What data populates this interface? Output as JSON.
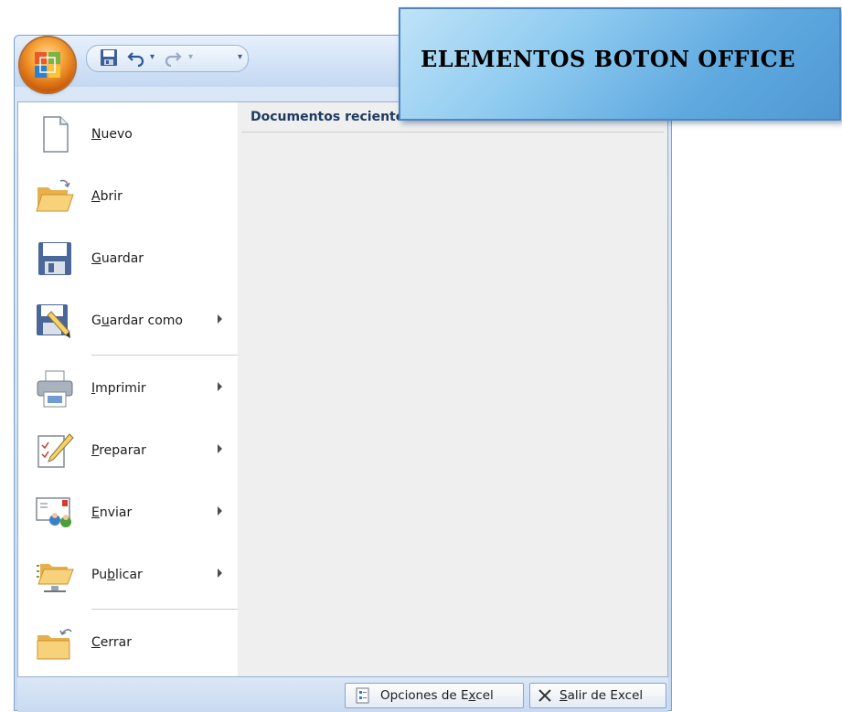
{
  "title_box": {
    "text": "ELEMENTOS BOTON OFFICE"
  },
  "recent": {
    "title": "Documentos recientes"
  },
  "menu_items": [
    {
      "pre": "",
      "key": "N",
      "post": "uevo",
      "icon": "new-document-icon",
      "submenu": false
    },
    {
      "pre": "",
      "key": "A",
      "post": "brir",
      "icon": "open-folder-icon",
      "submenu": false
    },
    {
      "pre": "",
      "key": "G",
      "post": "uardar",
      "icon": "save-icon",
      "submenu": false
    },
    {
      "pre": "G",
      "key": "u",
      "post": "ardar como",
      "icon": "save-as-icon",
      "submenu": true
    },
    {
      "pre": "",
      "key": "I",
      "post": "mprimir",
      "icon": "printer-icon",
      "submenu": true
    },
    {
      "pre": "",
      "key": "P",
      "post": "reparar",
      "icon": "prepare-icon",
      "submenu": true
    },
    {
      "pre": "",
      "key": "E",
      "post": "nviar",
      "icon": "send-icon",
      "submenu": true
    },
    {
      "pre": "Pu",
      "key": "b",
      "post": "licar",
      "icon": "publish-icon",
      "submenu": true
    },
    {
      "pre": "",
      "key": "C",
      "post": "errar",
      "icon": "close-folder-icon",
      "submenu": false
    }
  ],
  "footer": {
    "options": {
      "pre": "Opciones de E",
      "key": "x",
      "post": "cel"
    },
    "exit": {
      "pre": "",
      "key": "S",
      "post": "alir de Excel"
    }
  },
  "colors": {
    "accent": "#1e3a63",
    "frame": "#c6d9f0",
    "title_box": "#5fa9e0"
  }
}
